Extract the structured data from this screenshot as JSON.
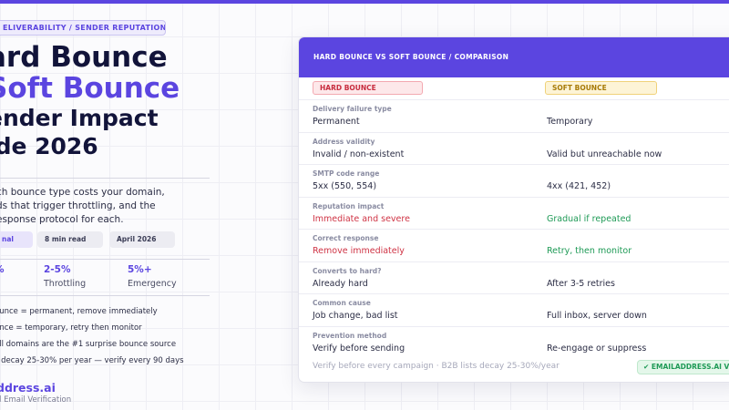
{
  "eyebrow": "ELIVERABILITY / SENDER REPUTATION",
  "title": {
    "line1": "ard Bounce",
    "line2": " Soft Bounce",
    "line3": "ender Impact",
    "line4": "ide 2026"
  },
  "description": {
    "line1": "ch bounce type costs your domain,",
    "line2": "ds that trigger throttling, and the",
    "line3": "esponse protocol for each."
  },
  "chips": [
    "nal",
    "8 min read",
    "April 2026"
  ],
  "stats": [
    {
      "value": "%",
      "label": ""
    },
    {
      "value": "2-5%",
      "label": "Throttling"
    },
    {
      "value": "5%+",
      "label": "Emergency"
    }
  ],
  "bullets": [
    "ounce = permanent, remove immediately",
    "unce = temporary, retry then monitor",
    "all domains are the #1 surprise bounce source",
    "s decay 25-30% per year — verify every 90 days"
  ],
  "brand": {
    "name": "ddress.ai",
    "tagline": "d Email Verification"
  },
  "table": {
    "header": "HARD BOUNCE VS SOFT BOUNCE / COMPARISON",
    "hard_label": "HARD BOUNCE",
    "soft_label": "SOFT BOUNCE",
    "rows": [
      {
        "label": "Delivery failure type",
        "hard": "Permanent",
        "soft": "Temporary"
      },
      {
        "label": "Address validity",
        "hard": "Invalid / non-existent",
        "soft": "Valid but unreachable now"
      },
      {
        "label": "SMTP code range",
        "hard": "5xx (550, 554)",
        "soft": "4xx (421, 452)"
      },
      {
        "label": "Reputation impact",
        "hard": "Immediate and severe",
        "soft": "Gradual if repeated"
      },
      {
        "label": "Correct response",
        "hard": "Remove immediately",
        "soft": "Retry, then monitor"
      },
      {
        "label": "Converts to hard?",
        "hard": "Already hard",
        "soft": "After 3-5 retries"
      },
      {
        "label": "Common cause",
        "hard": "Job change, bad list",
        "soft": "Full inbox, server down"
      },
      {
        "label": "Prevention method",
        "hard": "Verify before sending",
        "soft": "Re-engage or suppress"
      }
    ],
    "footer": "Verify before every campaign · B2B lists decay 25-30%/year",
    "badge": "✔ EMAILADDRESS.AI VE"
  },
  "colors": {
    "accent": "#5b45e0",
    "hard": "#cf3344",
    "soft_chip": "#a77a06",
    "positive": "#1e9a56"
  }
}
